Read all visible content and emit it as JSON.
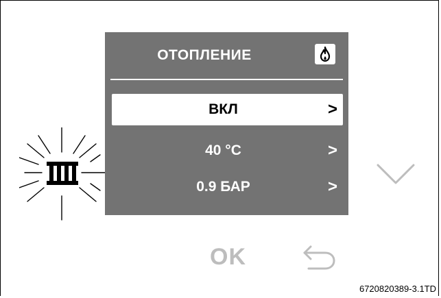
{
  "screen": {
    "title": "ОТОПЛЕНИЕ",
    "status_icon": "flame-icon",
    "items": [
      {
        "label": "ВКЛ",
        "chevron": ">",
        "selected": true
      },
      {
        "label": "40 °C",
        "chevron": ">",
        "selected": false
      },
      {
        "label": "0.9 БАР",
        "chevron": ">",
        "selected": false
      }
    ]
  },
  "buttons": {
    "ok_label": "OK",
    "back_icon": "back-arrow-icon",
    "down_icon": "chevron-down-icon",
    "heating_icon": "radiator-icon"
  },
  "figure_ref": "6720820389-3.1TD",
  "colors": {
    "screen_bg": "#737373",
    "text_light": "#ffffff",
    "button_inactive": "#bdbdbd"
  }
}
